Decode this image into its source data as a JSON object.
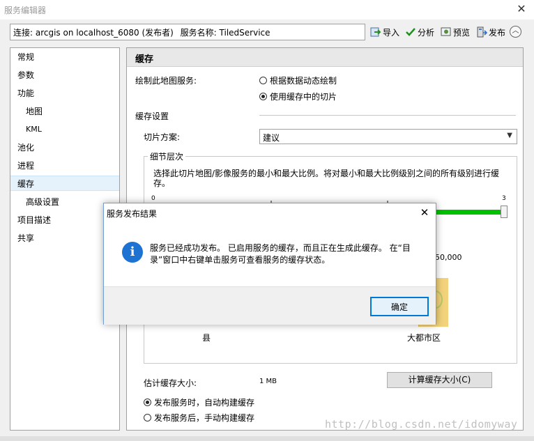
{
  "window": {
    "title": "服务编辑器"
  },
  "connection": {
    "label": "连接: arcgis on localhost_6080 (发布者)",
    "service_name": "服务名称: TiledService"
  },
  "toolbar": {
    "import": "导入",
    "analyze": "分析",
    "preview": "预览",
    "publish": "发布",
    "collapse": "︿"
  },
  "nav": {
    "items": [
      {
        "label": "常规"
      },
      {
        "label": "参数"
      },
      {
        "label": "功能"
      },
      {
        "label": "地图"
      },
      {
        "label": "KML"
      },
      {
        "label": "池化"
      },
      {
        "label": "进程"
      },
      {
        "label": "缓存"
      },
      {
        "label": "高级设置"
      },
      {
        "label": "项目描述"
      },
      {
        "label": "共享"
      }
    ]
  },
  "cache": {
    "title": "缓存",
    "draw_label": "绘制此地图服务:",
    "radio_dynamic": "根据数据动态绘制",
    "radio_cache": "使用缓存中的切片",
    "cache_settings": "缓存设置",
    "tile_scheme_label": "切片方案:",
    "tile_scheme_value": "建议",
    "lod_title": "细节层次",
    "lod_desc": "选择此切片地图/影像服务的最小和最大比例。将对最小和最大比例级别之间的所有级别进行缓存。",
    "slider_min": "0",
    "slider_max": "3",
    "scale_value": "50,000",
    "img_left_label": "县",
    "img_right_label": "大都市区",
    "est_size_label": "估计缓存大小:",
    "est_size_value": "1 MB",
    "calc_button": "计算缓存大小(C)",
    "build_auto": "发布服务时，自动构建缓存",
    "build_manual": "发布服务后，手动构建缓存"
  },
  "dialog": {
    "title": "服务发布结果",
    "message": "服务已经成功发布。 已启用服务的缓存，而且正在生成此缓存。 在“目录”窗口中右键单击服务可查看服务的缓存状态。",
    "ok": "确定",
    "info_glyph": "i"
  },
  "watermark": "http://blog.csdn.net/idomyway",
  "colors": {
    "slider": "#00c000",
    "info_icon": "#1e73d2",
    "dialog_border": "#6f9fd8",
    "ok_border": "#0078d7"
  }
}
